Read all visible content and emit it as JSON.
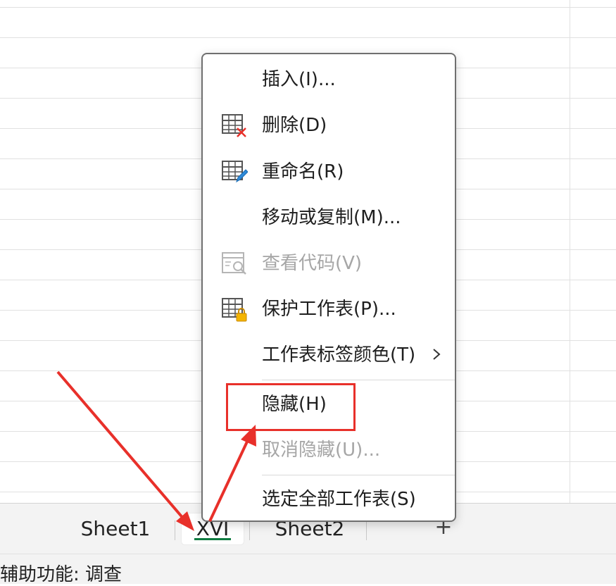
{
  "sheet_tabs": [
    {
      "label": "Sheet1",
      "active": false
    },
    {
      "label": "ⅩⅤⅠ",
      "active": true
    },
    {
      "label": "Sheet2",
      "active": false
    }
  ],
  "add_sheet_label": "+",
  "status_bar": {
    "accessibility": "辅助功能: 调查"
  },
  "context_menu": {
    "items": [
      {
        "label": "插入(I)...",
        "icon": null,
        "disabled": false
      },
      {
        "label": "删除(D)",
        "icon": "delete-sheet-icon",
        "disabled": false
      },
      {
        "label": "重命名(R)",
        "icon": "rename-sheet-icon",
        "disabled": false
      },
      {
        "label": "移动或复制(M)...",
        "icon": null,
        "disabled": false
      },
      {
        "label": "查看代码(V)",
        "icon": "view-code-icon",
        "disabled": true
      },
      {
        "label": "保护工作表(P)...",
        "icon": "protect-sheet-icon",
        "disabled": false
      },
      {
        "label": "工作表标签颜色(T)",
        "icon": null,
        "disabled": false,
        "submenu": true
      },
      {
        "label": "隐藏(H)",
        "icon": null,
        "disabled": false
      },
      {
        "label": "取消隐藏(U)...",
        "icon": null,
        "disabled": true
      },
      {
        "label": "选定全部工作表(S)",
        "icon": null,
        "disabled": false
      }
    ]
  },
  "colors": {
    "accent": "#107c41",
    "annotation": "#e8302a",
    "disabled_text": "#a6a6a6"
  }
}
